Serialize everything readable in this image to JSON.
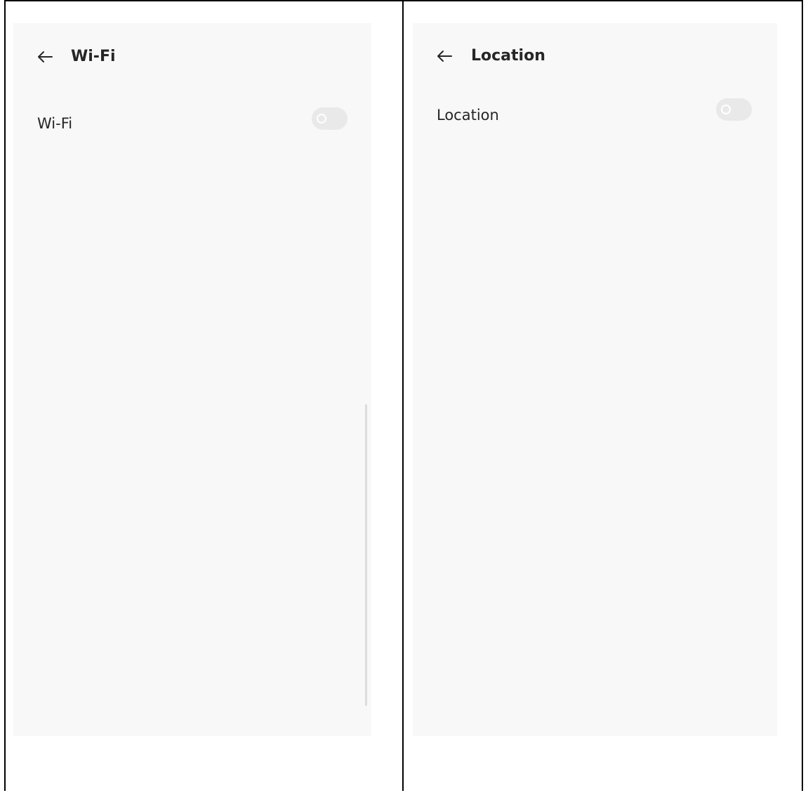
{
  "panels": [
    {
      "title": "Wi-Fi",
      "back_icon": "arrow-left-icon",
      "setting_label": "Wi-Fi",
      "toggle_on": false
    },
    {
      "title": "Location",
      "back_icon": "arrow-left-icon",
      "setting_label": "Location",
      "toggle_on": false
    }
  ],
  "colors": {
    "screen_bg": "#f8f8f8",
    "toggle_off": "#e9e9e9",
    "text": "#262626"
  }
}
